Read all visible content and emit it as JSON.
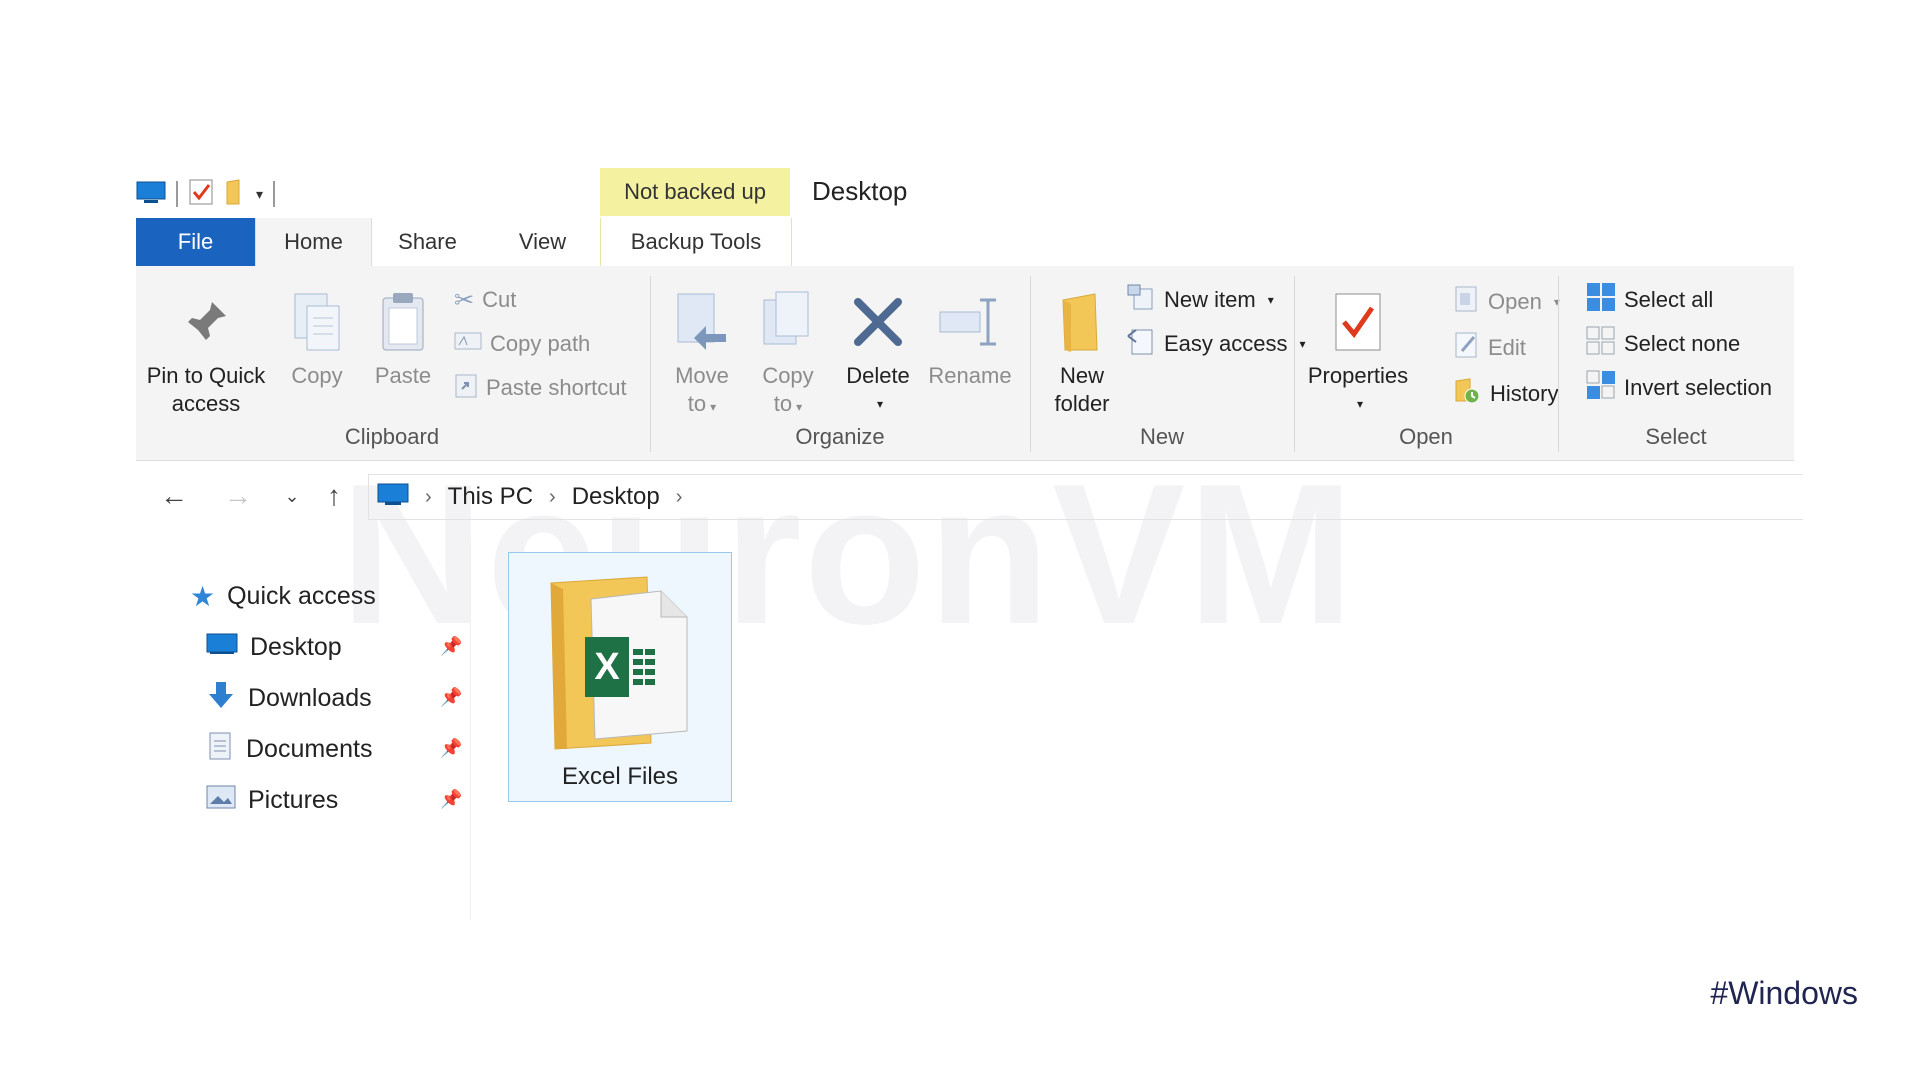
{
  "watermark": "NeuronVM",
  "titlebar": {
    "context_badge": "Not backed up",
    "window_title": "Desktop"
  },
  "tabs": {
    "file": "File",
    "home": "Home",
    "share": "Share",
    "view": "View",
    "backup_tools": "Backup Tools"
  },
  "ribbon": {
    "clipboard": {
      "group_label": "Clipboard",
      "pin_line1": "Pin to Quick",
      "pin_line2": "access",
      "copy": "Copy",
      "paste": "Paste",
      "cut": "Cut",
      "copy_path": "Copy path",
      "paste_shortcut": "Paste shortcut"
    },
    "organize": {
      "group_label": "Organize",
      "move_line1": "Move",
      "move_line2": "to",
      "copy_line1": "Copy",
      "copy_line2": "to",
      "delete": "Delete",
      "rename": "Rename"
    },
    "new": {
      "group_label": "New",
      "folder_line1": "New",
      "folder_line2": "folder",
      "new_item": "New item",
      "easy_access": "Easy access"
    },
    "open": {
      "group_label": "Open",
      "properties": "Properties",
      "open": "Open",
      "edit": "Edit",
      "history": "History"
    },
    "select": {
      "group_label": "Select",
      "select_all": "Select all",
      "select_none": "Select none",
      "invert_selection": "Invert selection"
    }
  },
  "address": {
    "crumbs": [
      "This PC",
      "Desktop"
    ]
  },
  "navpane": {
    "quick_access": "Quick access",
    "items": [
      {
        "label": "Desktop",
        "icon": "desktop-icon",
        "pinned": true
      },
      {
        "label": "Downloads",
        "icon": "download-icon",
        "pinned": true
      },
      {
        "label": "Documents",
        "icon": "documents-icon",
        "pinned": true
      },
      {
        "label": "Pictures",
        "icon": "pictures-icon",
        "pinned": true
      }
    ]
  },
  "content": {
    "items": [
      {
        "label": "Excel Files",
        "icon": "excel-folder-icon",
        "selected": true
      }
    ]
  },
  "footer_tag": "#Windows",
  "colors": {
    "file_tab": "#1a64c0",
    "badge": "#f4f2a0",
    "ribbon_bg": "#f4f4f4",
    "selection_border": "#99c9ea",
    "excel_green": "#1e7145",
    "folder_yellow": "#f3c658"
  }
}
